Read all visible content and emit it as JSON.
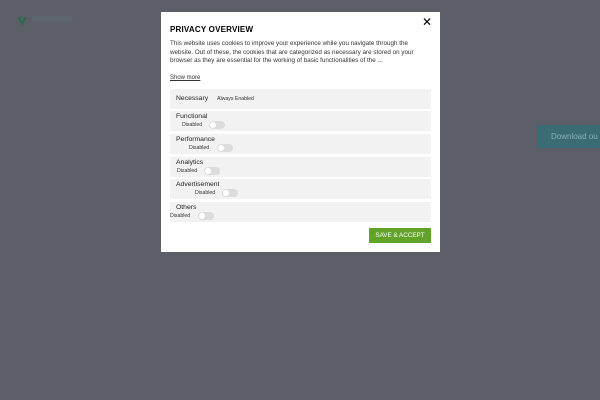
{
  "background": {
    "download_label": "Download ou"
  },
  "modal": {
    "title": "PRIVACY OVERVIEW",
    "description": "This website uses cookies to improve your experience while you navigate through the website. Out of these, the cookies that are categorized as necessary are stored on your browser as they are essential for the working of basic functionalities of the ...",
    "show_more": "Show more",
    "close_symbol": "✕",
    "save_label": "SAVE & ACCEPT",
    "categories": [
      {
        "name": "Necessary",
        "status": "Always Enabled"
      },
      {
        "name": "Functional",
        "status": "Disabled"
      },
      {
        "name": "Performance",
        "status": "Disabled"
      },
      {
        "name": "Analytics",
        "status": "Disabled"
      },
      {
        "name": "Advertisement",
        "status": "Disabled"
      },
      {
        "name": "Others",
        "status": "Disabled"
      }
    ]
  },
  "colors": {
    "overlay": "#5c5f68",
    "accent_green": "#61a229",
    "category_bg": "#f2f2f2",
    "toggle_off": "#dcdcdc"
  }
}
